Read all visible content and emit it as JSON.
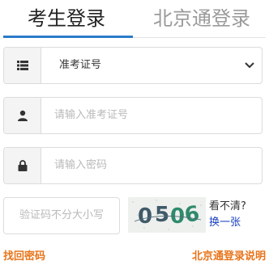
{
  "tabs": [
    {
      "label": "考生登录"
    },
    {
      "label": "北京通登录"
    }
  ],
  "form": {
    "id_type": {
      "selected": "准考证号"
    },
    "id_number": {
      "placeholder": "请输入准考证号"
    },
    "password": {
      "placeholder": "请输入密码"
    },
    "captcha": {
      "placeholder": "验证码不分大小写",
      "image_text": "0506",
      "unclear_label": "看不清?",
      "refresh_label": "换一张"
    }
  },
  "links": {
    "recover_password": "找回密码",
    "bjt_help": "北京通登录说明"
  },
  "colors": {
    "tab_accent": "#2a7bc8",
    "link_orange": "#e8741a",
    "refresh_blue": "#1a3fbf",
    "captcha_ink": "#3f5a68",
    "captcha_teal": "#2f8a6c"
  }
}
